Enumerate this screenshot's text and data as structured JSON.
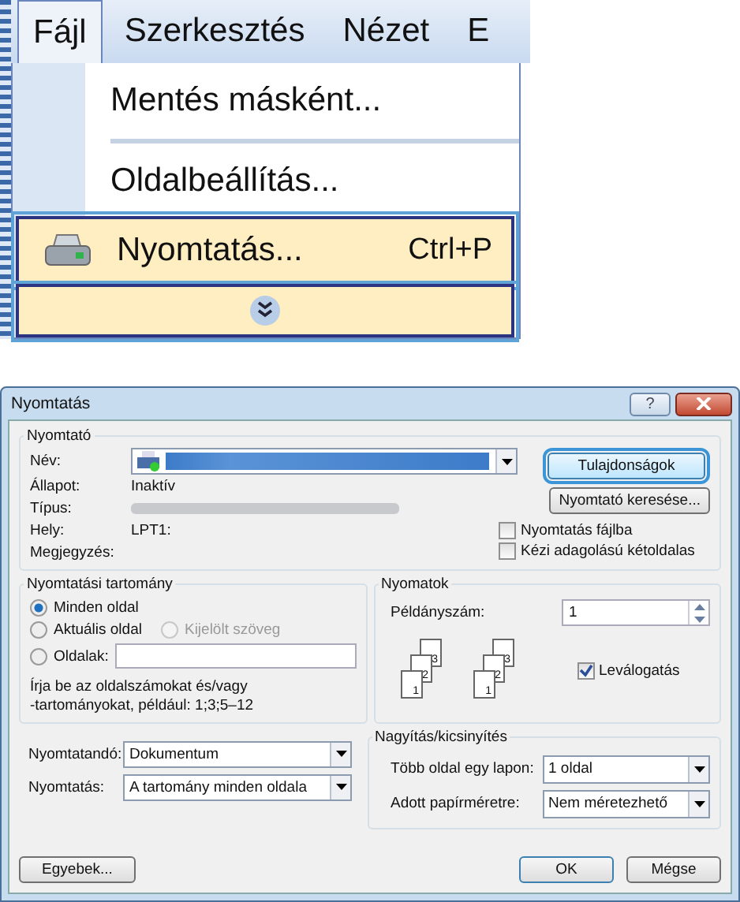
{
  "menu_bar": {
    "items": [
      {
        "label": "Fájl",
        "selected": true
      },
      {
        "label": "Szerkesztés",
        "selected": false
      },
      {
        "label": "Nézet",
        "selected": false
      },
      {
        "label": "E",
        "selected": false
      }
    ]
  },
  "menu": {
    "items": [
      {
        "kind": "item",
        "label": "Mentés másként...",
        "selected": false
      },
      {
        "kind": "separator"
      },
      {
        "kind": "item",
        "label": "Oldalbeállítás...",
        "selected": false
      },
      {
        "kind": "item",
        "label": "Nyomtatás...",
        "shortcut": "Ctrl+P",
        "icon": true,
        "selected": true
      },
      {
        "kind": "expand",
        "selected": true
      }
    ]
  },
  "dialog": {
    "title": "Nyomtatás",
    "help": "?",
    "printer": {
      "label": "Nyomtató",
      "name_label": "Név:",
      "status_label": "Állapot:",
      "status": "Inaktív",
      "type_label": "Típus:",
      "location_label": "Hely:",
      "location": "LPT1:",
      "comment_label": "Megjegyzés:",
      "properties_button": "Tulajdonságok",
      "find_button": "Nyomtató keresése...",
      "options": [
        {
          "label": "Nyomtatás fájlba",
          "checked": false
        },
        {
          "label": "Kézi adagolású kétoldalas",
          "checked": false
        }
      ]
    },
    "range": {
      "label": "Nyomtatási tartomány",
      "options": [
        {
          "label": "Minden oldal",
          "selected": true,
          "disabled": false
        },
        {
          "label": "Aktuális oldal",
          "selected": false,
          "disabled": false
        },
        {
          "label": "Kijelölt szöveg",
          "selected": false,
          "disabled": true
        },
        {
          "label": "Oldalak:",
          "selected": false,
          "disabled": false
        }
      ],
      "hint": "Írja be az oldalszámokat és/vagy\n-tartományokat, például: 1;3;5–12"
    },
    "copies": {
      "label": "Nyomatok",
      "count_label": "Példányszám:",
      "count": "1",
      "stacks": [
        [
          "3",
          "2",
          "1"
        ],
        [
          "3",
          "2",
          "1"
        ]
      ],
      "collate": {
        "label": "Leválogatás",
        "checked": true
      }
    },
    "print_what": {
      "label": "Nyomtatandó:",
      "value": "Dokumentum"
    },
    "print": {
      "label": "Nyomtatás:",
      "value": "A tartomány minden oldala"
    },
    "zoom": {
      "label": "Nagyítás/kicsinyítés",
      "pages_label": "Több oldal egy lapon:",
      "pages_value": "1 oldal",
      "scale_label": "Adott papírméretre:",
      "scale_value": "Nem méretezhető"
    },
    "buttons": {
      "options": "Egyebek...",
      "ok": "OK",
      "cancel": "Mégse"
    }
  }
}
